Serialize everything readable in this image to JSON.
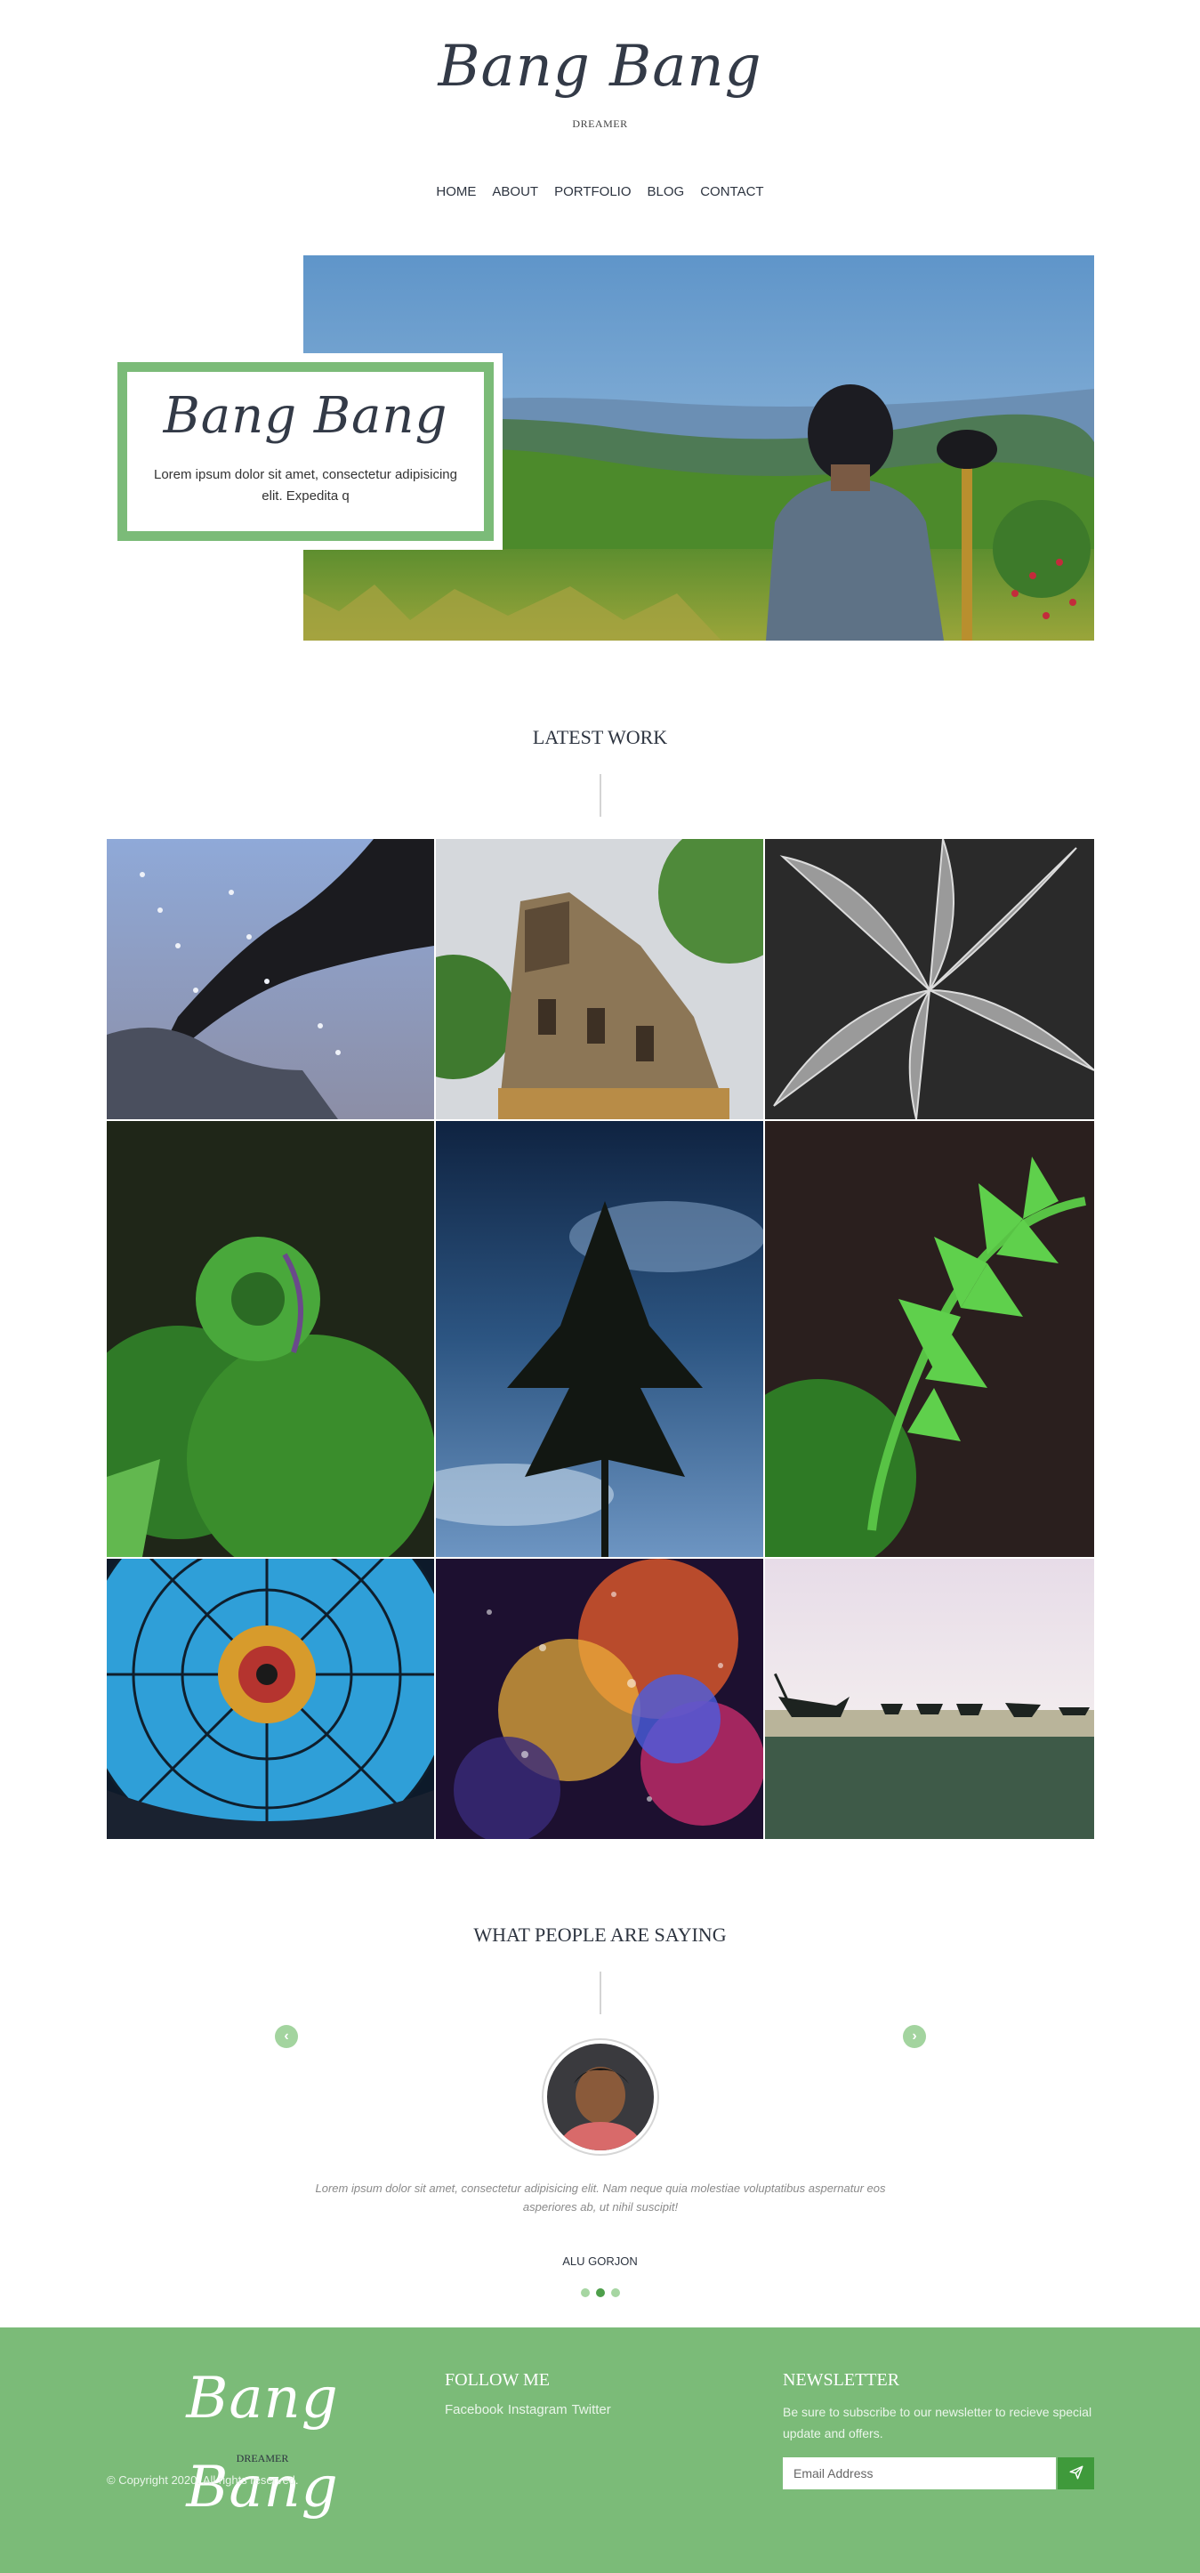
{
  "brand": {
    "logo": "Bang Bang",
    "tagline": "DREAMER"
  },
  "nav": {
    "items": [
      "HOME",
      "ABOUT",
      "PORTFOLIO",
      "BLOG",
      "CONTACT"
    ]
  },
  "hero": {
    "logo": "Bang Bang",
    "text": "Lorem ipsum dolor sit amet, consectetur adipisicing elit. Expedita q"
  },
  "latest_work": {
    "title": "LATEST WORK"
  },
  "testimonials": {
    "title": "WHAT PEOPLE ARE SAYING",
    "quote": "Lorem ipsum dolor sit amet, consectetur adipisicing elit. Nam neque quia molestiae voluptatibus aspernatur eos asperiores ab, ut nihil suscipit!",
    "author": "ALU GORJON",
    "prev_icon": "chevron-left-icon",
    "next_icon": "chevron-right-icon",
    "dots": 3,
    "active_dot": 2
  },
  "footer": {
    "logo": "Bang Bang",
    "tagline": "DREAMER",
    "copyright": "© Copyright 2020. All rights reserved.",
    "follow_title": "FOLLOW ME",
    "social": [
      "Facebook",
      "Instagram",
      "Twitter"
    ],
    "newsletter_title": "NEWSLETTER",
    "newsletter_text": "Be sure to subscribe to our newsletter to recieve special update and offers.",
    "email_placeholder": "Email Address",
    "send_icon": "paper-plane-icon"
  },
  "colors": {
    "accent": "#7bbb78",
    "accent_dark": "#3f9a3b",
    "text": "#2d3440"
  }
}
